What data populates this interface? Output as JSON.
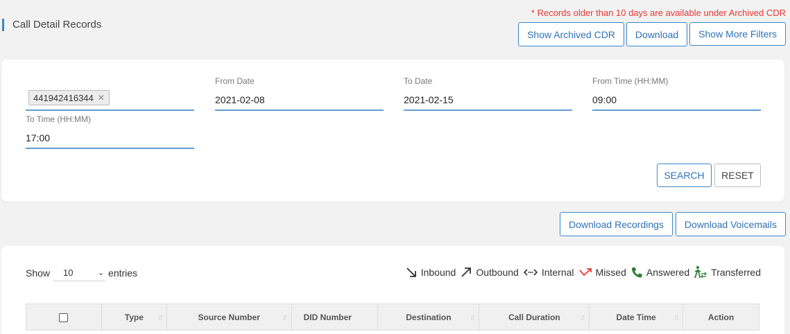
{
  "header": {
    "title": "Call Detail Records",
    "notice": "* Records older than 10 days are available under Archived CDR",
    "buttons": {
      "archived": "Show Archived CDR",
      "download": "Download",
      "filters": "Show More Filters"
    }
  },
  "filters": {
    "phone_chip": "441942416344",
    "from_date": {
      "label": "From Date",
      "value": "2021-02-08"
    },
    "to_date": {
      "label": "To Date",
      "value": "2021-02-15"
    },
    "from_time": {
      "label": "From Time (HH:MM)",
      "value": "09:00"
    },
    "to_time": {
      "label": "To Time (HH:MM)",
      "value": "17:00"
    },
    "search_label": "SEARCH",
    "reset_label": "RESET"
  },
  "downloads": {
    "recordings": "Download Recordings",
    "voicemails": "Download Voicemails"
  },
  "table": {
    "show_label": "Show",
    "entries_value": "10",
    "entries_label": "entries",
    "legend": {
      "inbound": "Inbound",
      "outbound": "Outbound",
      "internal": "Internal",
      "missed": "Missed",
      "answered": "Answered",
      "transferred": "Transferred"
    },
    "columns": [
      "Type",
      "Source Number",
      "DID Number",
      "Destination",
      "Call Duration",
      "Date Time",
      "Action"
    ],
    "colors": {
      "accent": "#3a86c8",
      "missed": "#e53935",
      "answered": "#2e7d32"
    }
  }
}
